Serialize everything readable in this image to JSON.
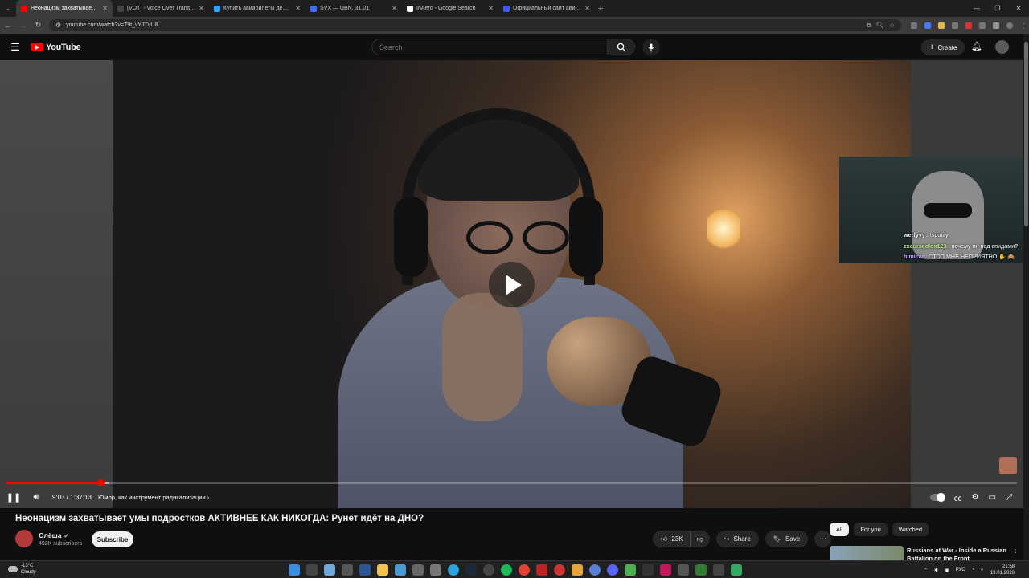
{
  "browser": {
    "tabs": [
      {
        "title": "Неонацизм захватывает ум",
        "active": true,
        "fav": "#ff0000"
      },
      {
        "title": "[VOT] - Voice Over Translation",
        "active": false,
        "fav": "#444"
      },
      {
        "title": "Купить авиабилеты дёшево со",
        "active": false,
        "fav": "#2aa3ff"
      },
      {
        "title": "SVX — UBN, 31.01",
        "active": false,
        "fav": "#3d6df2"
      },
      {
        "title": "InAero - Google Search",
        "active": false,
        "fav": "#ffffff"
      },
      {
        "title": "Официальный сайт авиакомп",
        "active": false,
        "fav": "#3d5af1"
      }
    ],
    "url": "youtube.com/watch?v=T9t_vYJTvU8"
  },
  "youtube": {
    "logo_text": "YouTube",
    "search_placeholder": "Search",
    "create_label": "Create"
  },
  "player": {
    "current_time": "9:03",
    "duration": "1:37:13",
    "time_display": "9:03 / 1:37:13",
    "played_fraction": 0.093,
    "loaded_fraction": 0.102,
    "chapter": "Юмор, как инструмент радикализации",
    "chat": [
      {
        "user": "werfyyy",
        "text": "!spotify",
        "cls": "u1"
      },
      {
        "user": "zxcursedlox123",
        "text": "почему он под спидами?",
        "cls": "u2"
      },
      {
        "user": "himicat",
        "text": "СТОП МНЕ НЕПРИЯТНО ✋ 🙈",
        "cls": "u3"
      }
    ]
  },
  "video": {
    "title": "Неонацизм захватывает умы подростков АКТИВНЕЕ КАК НИКОГДА: Рунет идёт на ДНО?",
    "channel": "Олёша",
    "subscribers": "492K subscribers",
    "subscribe_label": "Subscribe",
    "likes": "23K",
    "share_label": "Share",
    "save_label": "Save"
  },
  "sidebar": {
    "filters": [
      "All",
      "For you",
      "Watched"
    ],
    "selected_filter": "All",
    "recommendation_title": "Russians at War - Inside a Russian Battalion on the Front"
  },
  "taskbar": {
    "temperature": "-13°C",
    "weather": "Cloudy",
    "lang": "РУС",
    "time": "21:58",
    "date": "19.01.2026"
  }
}
